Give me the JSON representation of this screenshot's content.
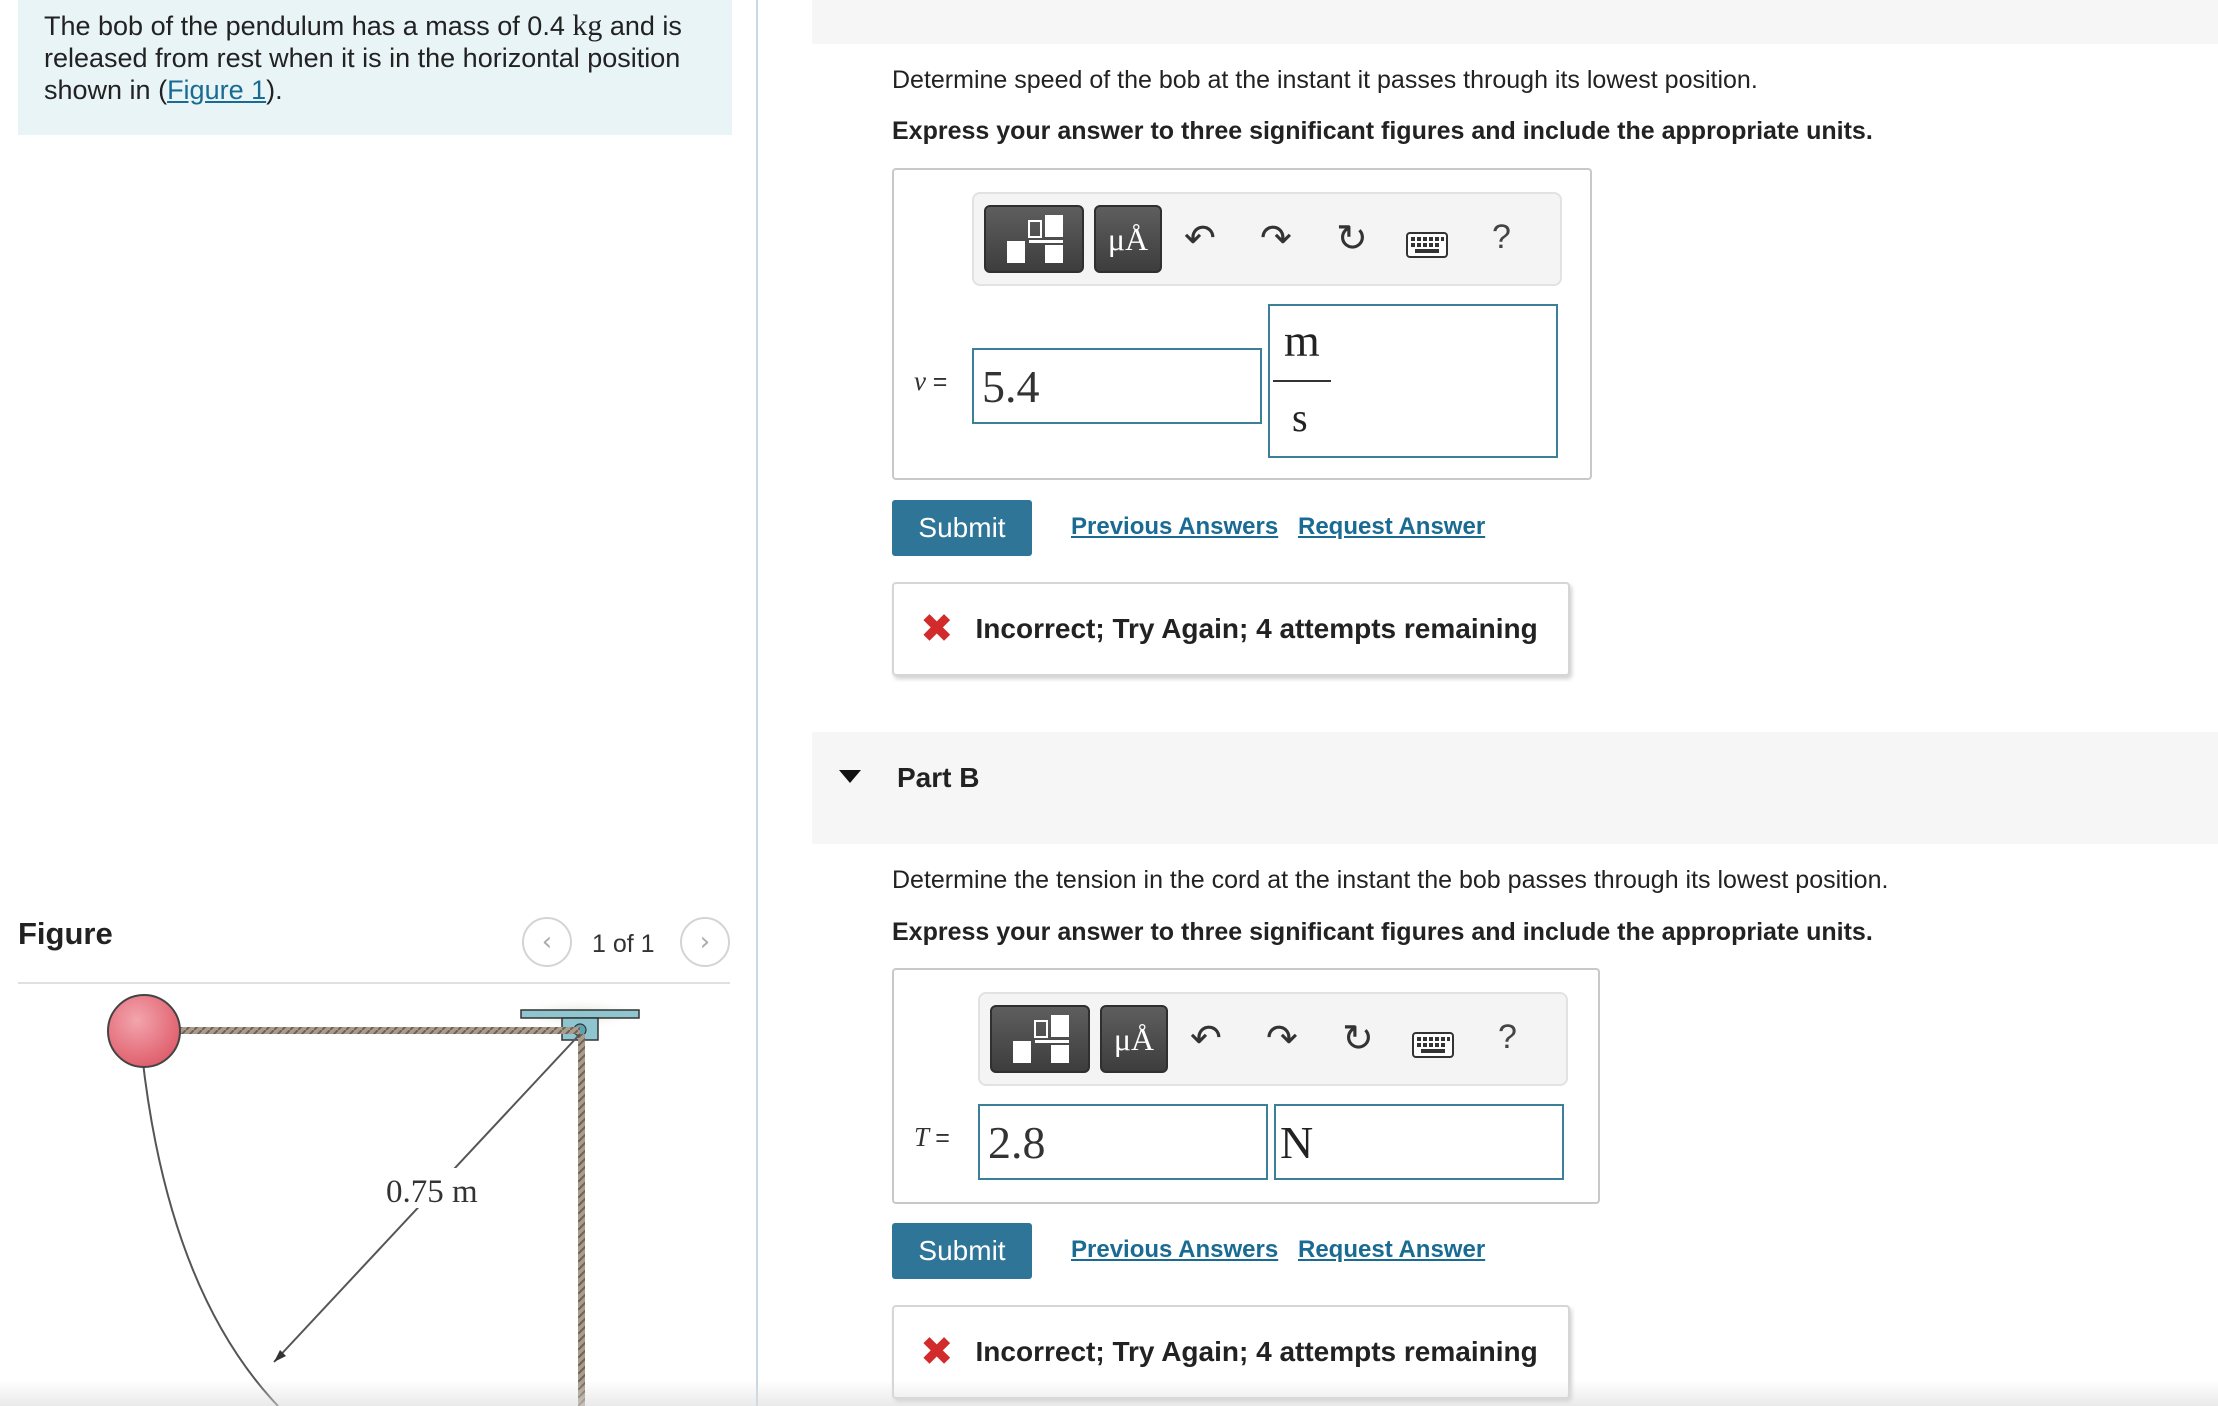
{
  "problem": {
    "text_before": "The bob of the pendulum has a mass of 0.4 ",
    "mass_unit": "kg",
    "text_after": " and is released from rest when it is in the horizontal position shown in (",
    "figure_link": "Figure 1",
    "text_end": ")."
  },
  "figure_panel": {
    "title": "Figure",
    "prev_icon": "chevron-left-icon",
    "next_icon": "chevron-right-icon",
    "counter": "1 of 1",
    "length_label": "0.75 m",
    "bob_color": "#e8707e"
  },
  "part_a": {
    "question": "Determine speed of the bob at the instant it passes through its lowest position.",
    "instruction": "Express your answer to three significant figures and include the appropriate units.",
    "toolbar": {
      "units_label": "μÅ",
      "help_label": "?"
    },
    "variable": "v",
    "equals": "=",
    "answer_value": "5.4",
    "unit_numerator": "m",
    "unit_denominator": "s",
    "submit_label": "Submit",
    "previous_answers": "Previous Answers",
    "request_answer": "Request Answer",
    "feedback": "Incorrect; Try Again; 4 attempts remaining"
  },
  "part_b": {
    "title": "Part B",
    "question": "Determine the tension in the cord at the instant the bob passes through its lowest position.",
    "instruction": "Express your answer to three significant figures and include the appropriate units.",
    "toolbar": {
      "units_label": "μÅ",
      "help_label": "?"
    },
    "variable": "T",
    "equals": "=",
    "answer_value": "2.8",
    "unit_value": "N",
    "submit_label": "Submit",
    "previous_answers": "Previous Answers",
    "request_answer": "Request Answer",
    "feedback": "Incorrect; Try Again; 4 attempts remaining"
  },
  "colors": {
    "accent": "#2e7597",
    "link": "#1a6b93",
    "error": "#d12b2b",
    "problem_bg": "#e8f4f6"
  }
}
